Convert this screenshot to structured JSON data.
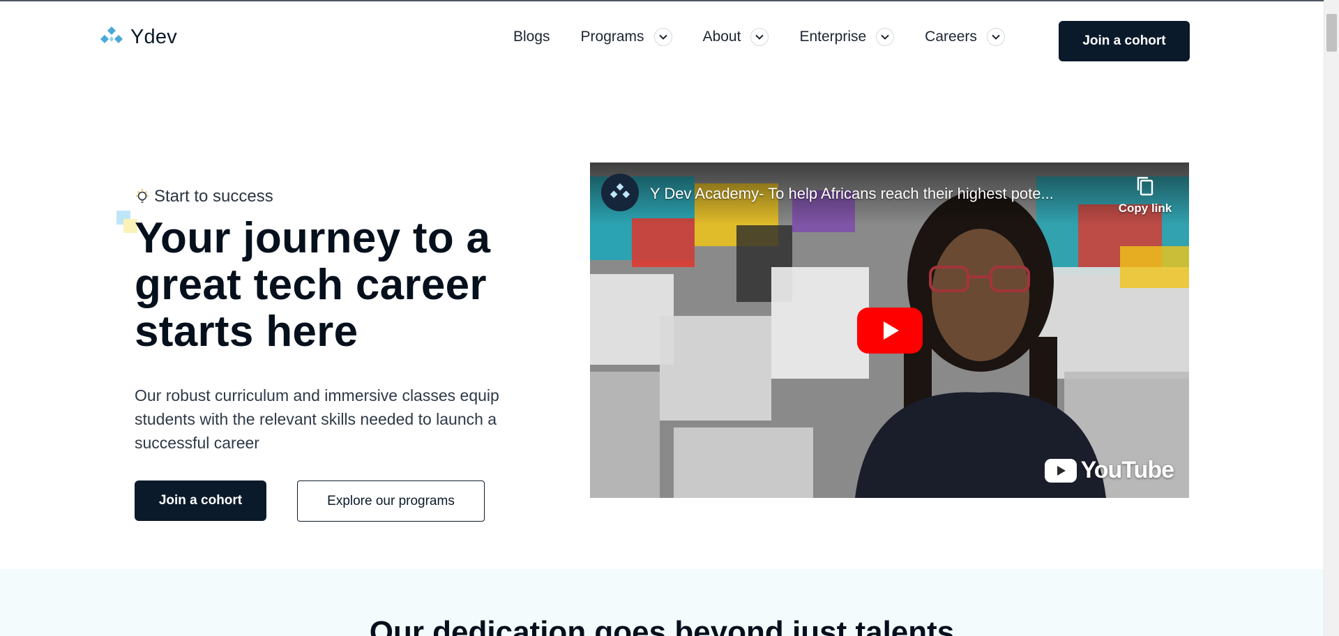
{
  "brand": {
    "name": "Ydev",
    "logo_icon": "ydev-logo-icon",
    "colors": {
      "primary": "#0b1a2a",
      "accent": "#4aa8d8",
      "band": "#f3fbfd"
    }
  },
  "nav": {
    "items": [
      {
        "label": "Blogs",
        "has_dropdown": false
      },
      {
        "label": "Programs",
        "has_dropdown": true
      },
      {
        "label": "About",
        "has_dropdown": true
      },
      {
        "label": "Enterprise",
        "has_dropdown": true
      },
      {
        "label": "Careers",
        "has_dropdown": true
      }
    ],
    "cta_label": "Join a cohort"
  },
  "hero": {
    "eyebrow": "Start to success",
    "eyebrow_icon": "lightbulb-icon",
    "title": "Your journey to a great tech career starts here",
    "description": "Our robust curriculum and immersive classes equip students with the relevant skills needed to launch a successful career",
    "primary_cta": "Join a cohort",
    "secondary_cta": "Explore our programs"
  },
  "video": {
    "title": "Y Dev Academy- To help Africans reach their highest pote...",
    "copy_link_label": "Copy link",
    "platform_label": "YouTube",
    "play_icon": "play-icon"
  },
  "section": {
    "title": "Our dedication goes beyond just talents"
  }
}
